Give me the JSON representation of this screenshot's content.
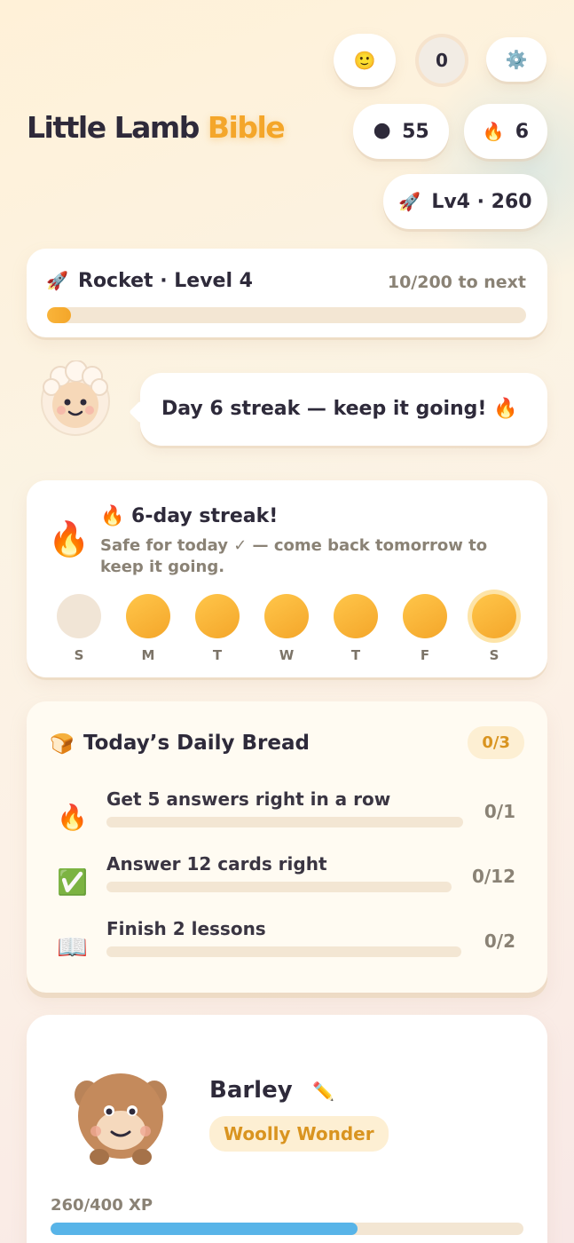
{
  "header": {
    "title_main": "Little Lamb",
    "title_accent": "Bible",
    "mood_icon": "smiley-face-emoji",
    "mood_emoji": "🙂",
    "notification_count": "0",
    "settings_emoji": "⚙️",
    "gems_emoji": "🌑",
    "gems_value": "55",
    "streak_emoji": "🔥",
    "streak_value": "6",
    "level_emoji": "🚀",
    "level_badge": "Lv4 · 260"
  },
  "level_card": {
    "emoji": "🚀",
    "title": "Rocket · Level 4",
    "progress_text": "10/200 to next",
    "progress_fraction": 0.05
  },
  "mascot_bubble": {
    "message": "Day 6 streak — keep it going! 🔥"
  },
  "streak_card": {
    "big_emoji": "🔥",
    "title": "🔥 6-day streak!",
    "subtitle": "Safe for today ✓ — come back tomorrow to keep it going.",
    "days": [
      {
        "label": "S",
        "done": false,
        "today": false
      },
      {
        "label": "M",
        "done": true,
        "today": false
      },
      {
        "label": "T",
        "done": true,
        "today": false
      },
      {
        "label": "W",
        "done": true,
        "today": false
      },
      {
        "label": "T",
        "done": true,
        "today": false
      },
      {
        "label": "F",
        "done": true,
        "today": false
      },
      {
        "label": "S",
        "done": true,
        "today": true
      }
    ]
  },
  "daily_bread": {
    "emoji": "🍞",
    "title": "Today’s Daily Bread",
    "count": "0/3",
    "quests": [
      {
        "emoji": "🔥",
        "label": "Get 5 answers right in a row",
        "count": "0/1",
        "progress": 0
      },
      {
        "emoji": "✅",
        "label": "Answer 12 cards right",
        "count": "0/12",
        "progress": 0
      },
      {
        "emoji": "📖",
        "label": "Finish 2 lessons",
        "count": "0/2",
        "progress": 0
      }
    ]
  },
  "pet_card": {
    "name": "Barley",
    "edit_emoji": "✏️",
    "title_badge": "Woolly Wonder",
    "xp_text": "260/400 XP",
    "xp_fraction": 0.65
  },
  "colors": {
    "accent": "#f4a62a",
    "xp_blue": "#58b4e8",
    "track": "#f3e6d3",
    "badge_bg": "#fdefd3",
    "badge_text": "#d99420"
  }
}
